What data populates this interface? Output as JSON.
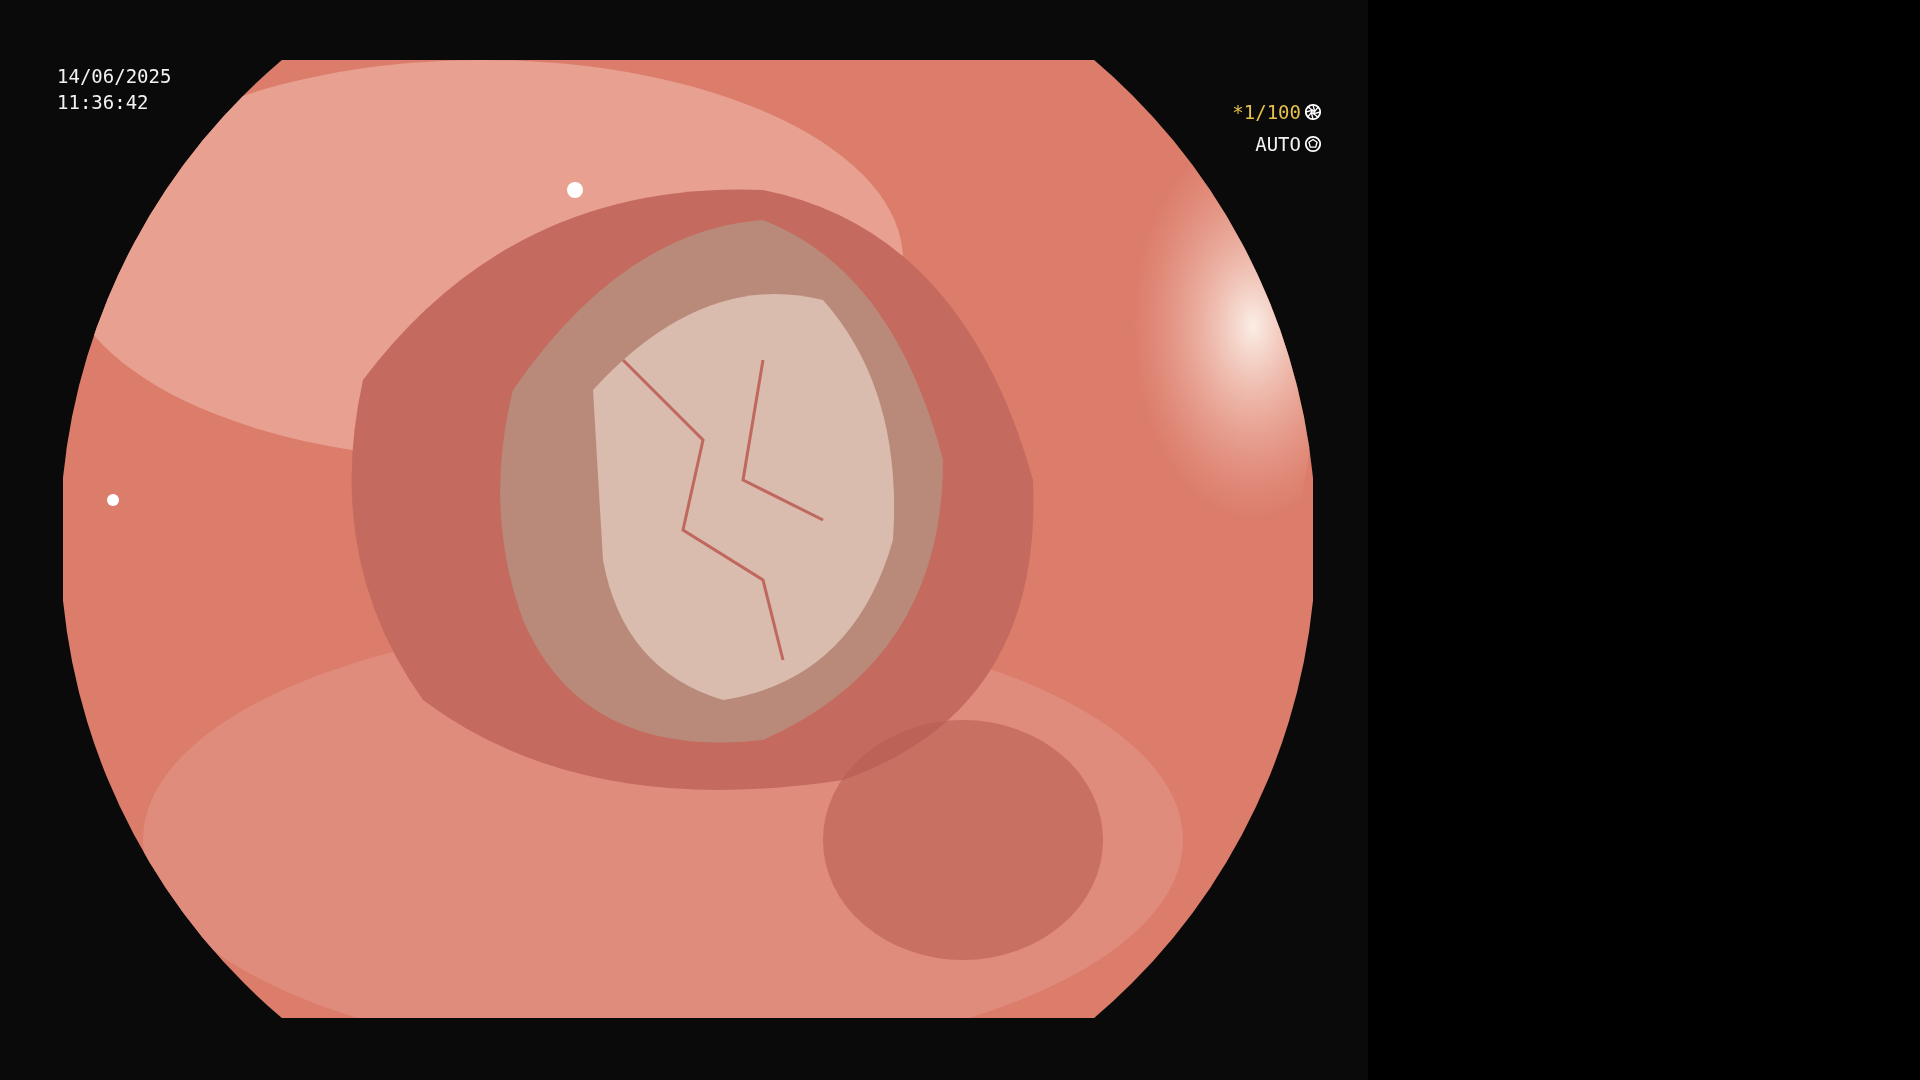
{
  "overlay": {
    "date": "14/06/2025",
    "time": "11:36:42",
    "shutter": "*1/100",
    "mode": "AUTO"
  }
}
